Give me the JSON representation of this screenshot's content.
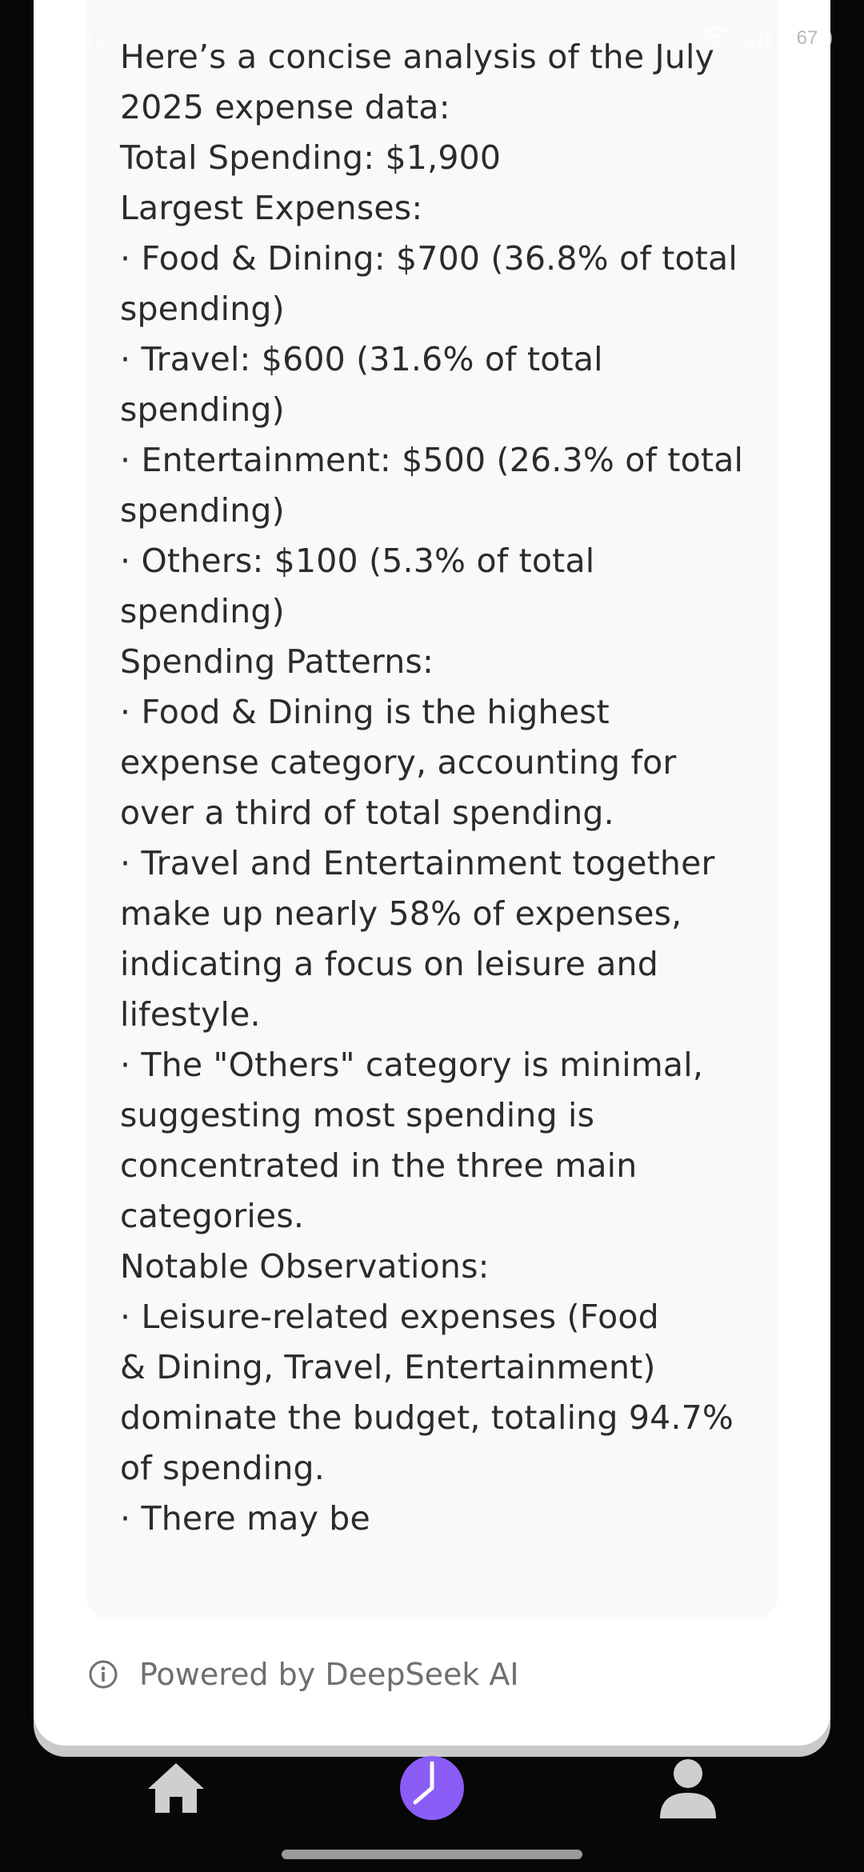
{
  "status_bar": {
    "time": "5:41",
    "battery": "67"
  },
  "response": {
    "text": "Here’s a concise analysis of the July\n2025 expense data:\nTotal Spending: $1,900\nLargest Expenses:\n· Food & Dining: $700 (36.8% of total\nspending)\n· Travel: $600 (31.6% of total\nspending)\n· Entertainment: $500 (26.3% of total\nspending)\n· Others: $100 (5.3% of total\nspending)\nSpending Patterns:\n· Food & Dining is the highest\nexpense category, accounting for\nover a third of total spending.\n· Travel and Entertainment together\nmake up nearly 58% of expenses,\nindicating a focus on leisure and\nlifestyle.\n· The \"Others\" category is minimal,\nsuggesting most spending is\nconcentrated in the three main\ncategories.\nNotable Observations:\n· Leisure-related expenses (Food\n& Dining, Travel, Entertainment)\ndominate the budget, totaling 94.7%\nof spending.\n· There may be"
  },
  "footer": {
    "icon": "info-icon",
    "text": "Powered by DeepSeek AI"
  },
  "bottom_nav": {
    "items": [
      {
        "icon": "home-icon",
        "active": false
      },
      {
        "icon": "pie-chart-icon",
        "active": true
      },
      {
        "icon": "profile-icon",
        "active": false
      }
    ]
  },
  "colors": {
    "accent": "#8b5cf6",
    "nav_inactive": "#cfcfcf",
    "background": "#070707",
    "sheet": "#ffffff",
    "card": "#f8f9fb"
  }
}
